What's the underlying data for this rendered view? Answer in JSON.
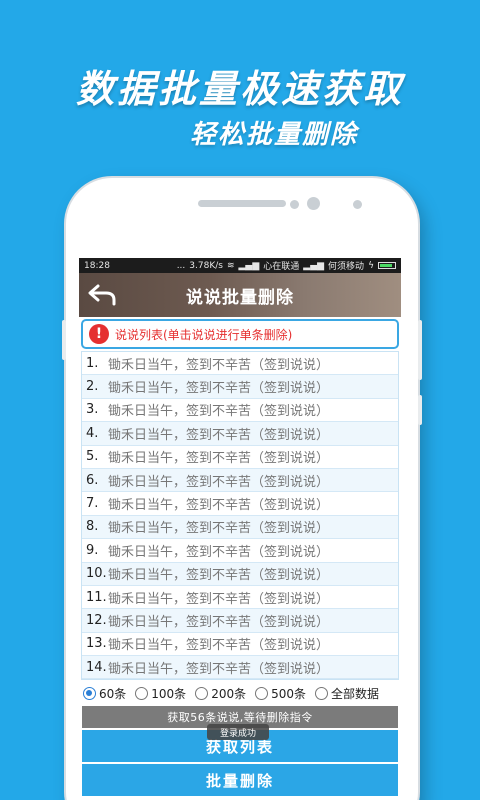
{
  "promo": {
    "title": "数据批量极速获取",
    "subtitle": "轻松批量删除"
  },
  "statusbar": {
    "time": "18:28",
    "dots": "...",
    "speed": "3.78K/s",
    "carrier1": "心在联通",
    "carrier2": "何须移动"
  },
  "header": {
    "title": "说说批量删除"
  },
  "notice": {
    "text": "说说列表(单击说说进行单条删除)"
  },
  "list": {
    "items": [
      {
        "num": "1.",
        "text": "锄禾日当午，签到不辛苦（签到说说）"
      },
      {
        "num": "2.",
        "text": "锄禾日当午，签到不辛苦（签到说说）"
      },
      {
        "num": "3.",
        "text": "锄禾日当午，签到不辛苦（签到说说）"
      },
      {
        "num": "4.",
        "text": "锄禾日当午，签到不辛苦（签到说说）"
      },
      {
        "num": "5.",
        "text": "锄禾日当午，签到不辛苦（签到说说）"
      },
      {
        "num": "6.",
        "text": "锄禾日当午，签到不辛苦（签到说说）"
      },
      {
        "num": "7.",
        "text": "锄禾日当午，签到不辛苦（签到说说）"
      },
      {
        "num": "8.",
        "text": "锄禾日当午，签到不辛苦（签到说说）"
      },
      {
        "num": "9.",
        "text": "锄禾日当午，签到不辛苦（签到说说）"
      },
      {
        "num": "10.",
        "text": "锄禾日当午，签到不辛苦（签到说说）"
      },
      {
        "num": "11.",
        "text": "锄禾日当午，签到不辛苦（签到说说）"
      },
      {
        "num": "12.",
        "text": "锄禾日当午，签到不辛苦（签到说说）"
      },
      {
        "num": "13.",
        "text": "锄禾日当午，签到不辛苦（签到说说）"
      },
      {
        "num": "14.",
        "text": "锄禾日当午，签到不辛苦（签到说说）"
      }
    ]
  },
  "options": {
    "selected": "60条",
    "items": [
      "60条",
      "100条",
      "200条",
      "500条",
      "全部数据"
    ]
  },
  "status_message": "获取56条说说,等待删除指令",
  "buttons": {
    "fetch_list": "获取列表",
    "batch_delete": "批量删除"
  },
  "toast": "登录成功",
  "colors": {
    "background": "#23a8e8",
    "accent": "#2ba6e6",
    "warning": "#e53030"
  }
}
